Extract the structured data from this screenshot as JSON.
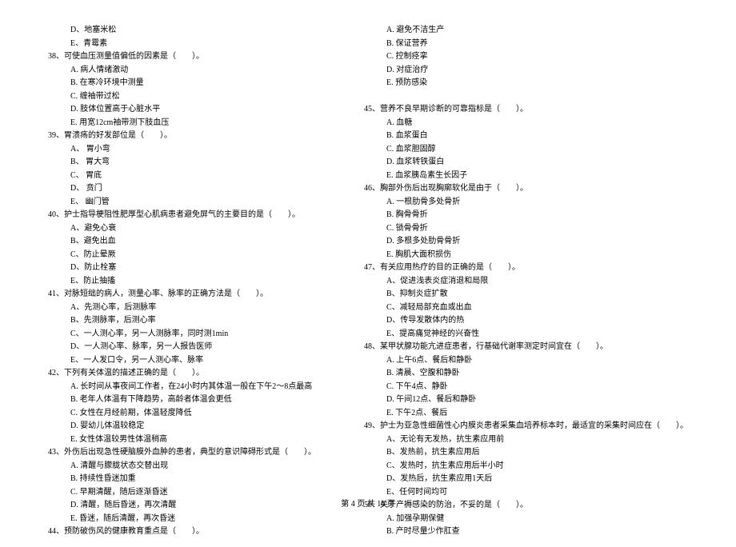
{
  "left": [
    {
      "cls": "opt",
      "t": "D、地塞米松"
    },
    {
      "cls": "opt",
      "t": "E、青霉素"
    },
    {
      "cls": "stem",
      "t": "38、可使血压测量值偏低的因素是（　　）。"
    },
    {
      "cls": "opt",
      "t": "A. 病人情绪激动"
    },
    {
      "cls": "opt",
      "t": "B. 在寒冷环境中测量"
    },
    {
      "cls": "opt",
      "t": "C. 缠袖带过松"
    },
    {
      "cls": "opt",
      "t": "D. 肢体位置高于心脏水平"
    },
    {
      "cls": "opt",
      "t": "E. 用宽12cm袖带测下肢血压"
    },
    {
      "cls": "stem",
      "t": "39、胃溃疡的好发部位是（　　）。"
    },
    {
      "cls": "opt",
      "t": "A、 胃小弯"
    },
    {
      "cls": "opt",
      "t": "B、 胃大弯"
    },
    {
      "cls": "opt",
      "t": "C、 胃底"
    },
    {
      "cls": "opt",
      "t": "D、 贲门"
    },
    {
      "cls": "opt",
      "t": "E、 幽门管"
    },
    {
      "cls": "stem",
      "t": "40、护士指导梗阻性肥厚型心肌病患者避免屏气的主要目的是（　　）。"
    },
    {
      "cls": "opt",
      "t": "A、避免心衰"
    },
    {
      "cls": "opt",
      "t": "B、避免出血"
    },
    {
      "cls": "opt",
      "t": "C、防止晕厥"
    },
    {
      "cls": "opt",
      "t": "D、防止栓塞"
    },
    {
      "cls": "opt",
      "t": "E、防止抽搐"
    },
    {
      "cls": "stem",
      "t": "41、对脉短绌的病人，测量心率、脉率的正确方法是（　　）。"
    },
    {
      "cls": "opt",
      "t": "A、先测心率，后测脉率"
    },
    {
      "cls": "opt",
      "t": "B、先测脉率，后测心率"
    },
    {
      "cls": "opt",
      "t": "C、一人测心率，另一人测脉率，同时测1min"
    },
    {
      "cls": "opt",
      "t": "D、一人测心率、脉率，另一人报告医师"
    },
    {
      "cls": "opt",
      "t": "E、一人发口令，另一人测心率、脉率"
    },
    {
      "cls": "stem",
      "t": "42、下列有关体温的描述正确的是（　　）。"
    },
    {
      "cls": "opt",
      "t": "A. 长时间从事夜间工作者，在24小时内其体温一般在下午2～8点最高"
    },
    {
      "cls": "opt",
      "t": "B. 老年人体温有下降趋势，高龄者体温会更低"
    },
    {
      "cls": "opt",
      "t": "C. 女性在月经前期，体温轻度降低"
    },
    {
      "cls": "opt",
      "t": "D. 婴幼儿体温较稳定"
    },
    {
      "cls": "opt",
      "t": "E. 女性体温较男性体温稍高"
    },
    {
      "cls": "stem",
      "t": "43、外伤后出现急性硬脑膜外血肿的患者，典型的意识障碍形式是（　　）。"
    },
    {
      "cls": "opt",
      "t": "A. 清醒与朦胧状态交替出现"
    },
    {
      "cls": "opt",
      "t": "B. 持续性昏迷加重"
    },
    {
      "cls": "opt",
      "t": "C. 早期清醒，随后逐渐昏迷"
    },
    {
      "cls": "opt",
      "t": "D. 清醒，随后昏迷，再次清醒"
    },
    {
      "cls": "opt",
      "t": "E. 昏迷，随后清醒，再次昏迷"
    },
    {
      "cls": "stem",
      "t": "44、预防破伤风的健康教育重点是（　　）。"
    }
  ],
  "right": [
    {
      "cls": "opt",
      "t": "A. 避免不洁生产"
    },
    {
      "cls": "opt",
      "t": "B. 保证营养"
    },
    {
      "cls": "opt",
      "t": "C. 控制痉挛"
    },
    {
      "cls": "opt",
      "t": "D. 对症治疗"
    },
    {
      "cls": "opt",
      "t": "E. 预防感染"
    },
    {
      "cls": "stem",
      "t": "　"
    },
    {
      "cls": "stem",
      "t": "45、营养不良早期诊断的可靠指标是（　　）。"
    },
    {
      "cls": "opt",
      "t": "A. 血糖"
    },
    {
      "cls": "opt",
      "t": "B. 血浆蛋白"
    },
    {
      "cls": "opt",
      "t": "C. 血浆胆固醇"
    },
    {
      "cls": "opt",
      "t": "D. 血浆转铁蛋白"
    },
    {
      "cls": "opt",
      "t": "E. 血浆胰岛素生长因子"
    },
    {
      "cls": "stem",
      "t": "46、胸部外伤后出现胸廓软化是由于（　　）。"
    },
    {
      "cls": "opt",
      "t": "A. 一根肋骨多处骨折"
    },
    {
      "cls": "opt",
      "t": "B. 胸骨骨折"
    },
    {
      "cls": "opt",
      "t": "C. 锁骨骨折"
    },
    {
      "cls": "opt",
      "t": "D. 多根多处肋骨骨折"
    },
    {
      "cls": "opt",
      "t": "E. 胸肌大面积损伤"
    },
    {
      "cls": "stem",
      "t": "47、有关应用热疗的目的正确的是（　　）。"
    },
    {
      "cls": "opt",
      "t": "A、促进浅表炎症消退和局限"
    },
    {
      "cls": "opt",
      "t": "B、抑制炎症扩散"
    },
    {
      "cls": "opt",
      "t": "C、减轻局部充血或出血"
    },
    {
      "cls": "opt",
      "t": "D、传导发散体内的热"
    },
    {
      "cls": "opt",
      "t": "E、提高痛觉神经的兴奋性"
    },
    {
      "cls": "stem",
      "t": "48、某甲状腺功能亢进症患者，行基础代谢率测定时间宜在（　　）。"
    },
    {
      "cls": "opt",
      "t": "A. 上午6点、餐后和静卧"
    },
    {
      "cls": "opt",
      "t": "B. 清晨、空腹和静卧"
    },
    {
      "cls": "opt",
      "t": "C. 下午4点、静卧"
    },
    {
      "cls": "opt",
      "t": "D. 午间12点、餐后和静卧"
    },
    {
      "cls": "opt",
      "t": "E. 下午2点、餐后"
    },
    {
      "cls": "stem",
      "t": "49、护士为亚急性细菌性心内膜炎患者采集血培养标本时，最适宜的采集时间应在（　　）。"
    },
    {
      "cls": "opt",
      "t": "A、无论有无发热，抗生素应用前"
    },
    {
      "cls": "opt",
      "t": "B、发热前，抗生素应用后"
    },
    {
      "cls": "opt",
      "t": "C、发热时，抗生素应用后半小时"
    },
    {
      "cls": "opt",
      "t": "D、发热后，抗生素应用1天后"
    },
    {
      "cls": "opt",
      "t": "E、任何时间均可"
    },
    {
      "cls": "stem",
      "t": "50、关于产褥感染的防治，不妥的是（　　）。"
    },
    {
      "cls": "opt",
      "t": "A. 加强孕期保健"
    },
    {
      "cls": "opt",
      "t": "B. 产时尽量少作肛查"
    }
  ],
  "footer": "第 4 页 共 16 页"
}
